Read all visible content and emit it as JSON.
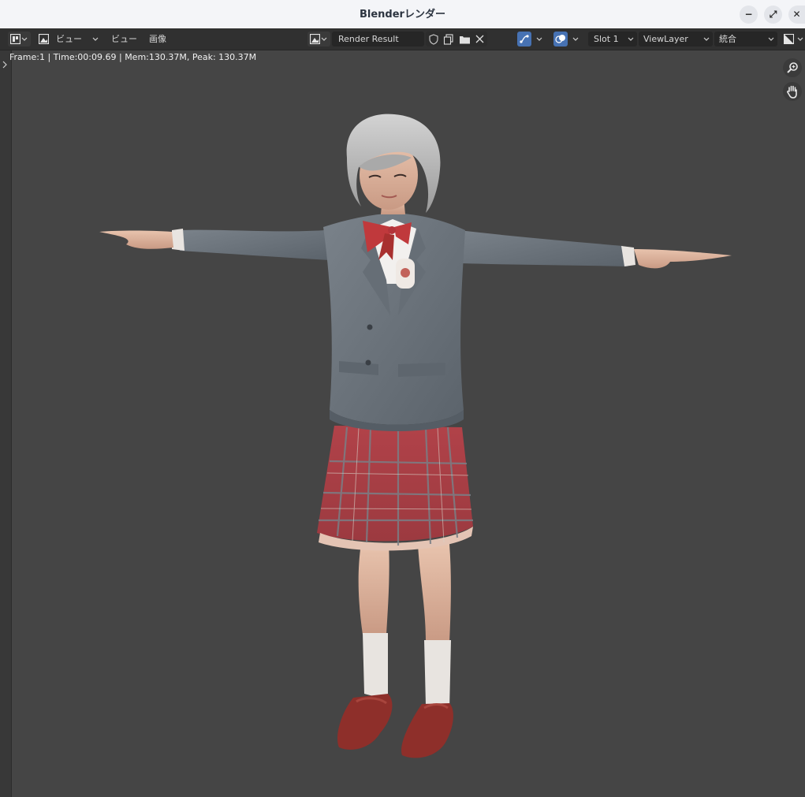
{
  "window": {
    "title": "Blenderレンダー",
    "minimize_glyph": "−",
    "maximize_glyph": "⤢",
    "close_glyph": "✕"
  },
  "toolbar": {
    "editor_type_icon": "image-editor-icon",
    "view_mode_label": "ビュー",
    "menu_view": "ビュー",
    "menu_image": "画像",
    "image_name": "Render Result",
    "slot": "Slot 1",
    "view_layer": "ViewLayer",
    "pass": "統合"
  },
  "stats": {
    "text": "Frame:1 | Time:00:09.69 | Mem:130.37M, Peak: 130.37M"
  },
  "side_tools": [
    "zoom-icon",
    "hand-pan-icon"
  ],
  "colors": {
    "accent_blue": "#4772b3",
    "viewport_bg": "#454545",
    "blazer_gray": "#6b737b",
    "skirt_red": "#b6444a",
    "shoe_red": "#8e2f2a",
    "hair_gray": "#c4c4c4"
  }
}
